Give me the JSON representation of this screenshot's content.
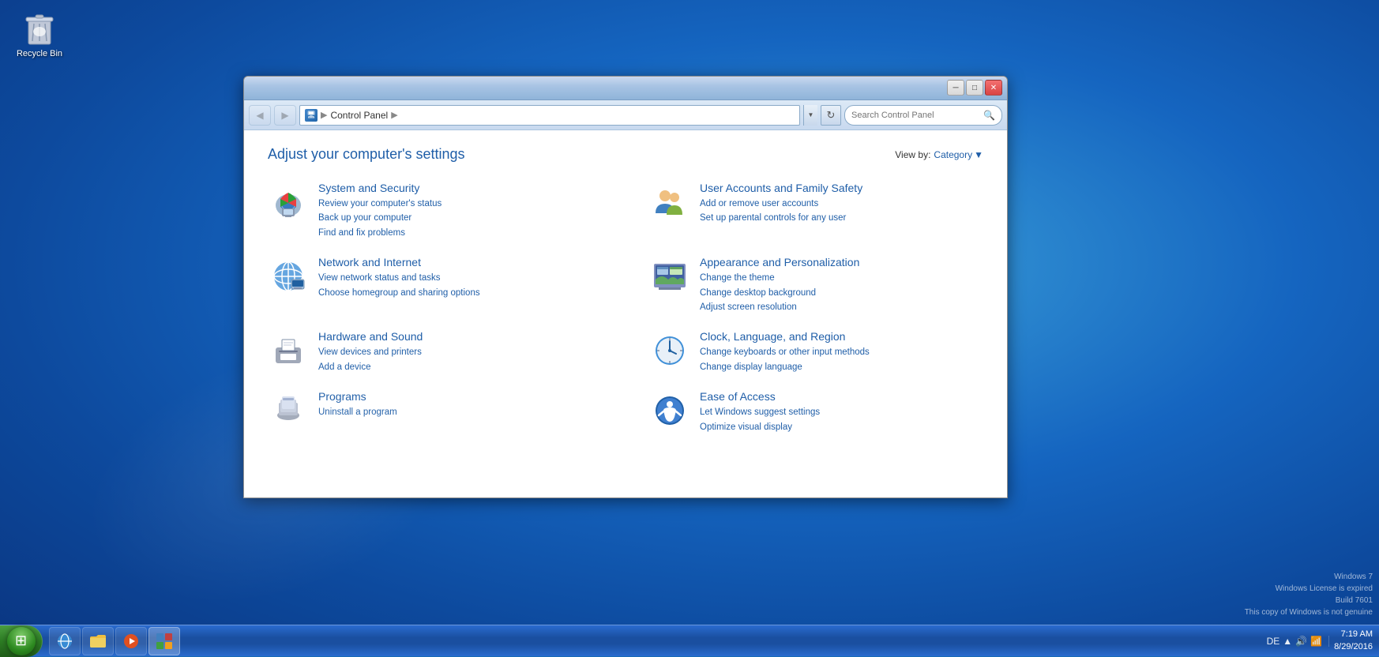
{
  "desktop": {
    "recycle_bin_label": "Recycle Bin"
  },
  "taskbar": {
    "start_label": "Start",
    "items": [
      {
        "name": "Internet Explorer",
        "icon": "ie"
      },
      {
        "name": "File Explorer",
        "icon": "folder"
      },
      {
        "name": "Media Player",
        "icon": "media"
      },
      {
        "name": "Control Panel",
        "icon": "control",
        "active": true
      }
    ],
    "clock": {
      "time": "7:19 AM",
      "date": "8/29/2016"
    },
    "tray_icons": [
      "DE",
      "▲",
      "🔊",
      "📶"
    ]
  },
  "watermark": {
    "line1": "Windows 7",
    "line2": "Windows License is expired",
    "line3": "Build 7601",
    "line4": "This copy of Windows is not genuine"
  },
  "window": {
    "title": "Control Panel",
    "nav": {
      "address_icon": "🖥",
      "address_parts": [
        "Control Panel"
      ],
      "search_placeholder": "Search Control Panel",
      "refresh_icon": "↻"
    },
    "content": {
      "heading": "Adjust your computer's settings",
      "view_by_label": "View by:",
      "view_by_value": "Category",
      "categories": [
        {
          "id": "system-security",
          "title": "System and Security",
          "links": [
            "Review your computer's status",
            "Back up your computer",
            "Find and fix problems"
          ]
        },
        {
          "id": "user-accounts",
          "title": "User Accounts and Family Safety",
          "links": [
            "Add or remove user accounts",
            "Set up parental controls for any user"
          ]
        },
        {
          "id": "network-internet",
          "title": "Network and Internet",
          "links": [
            "View network status and tasks",
            "Choose homegroup and sharing options"
          ]
        },
        {
          "id": "appearance",
          "title": "Appearance and Personalization",
          "links": [
            "Change the theme",
            "Change desktop background",
            "Adjust screen resolution"
          ]
        },
        {
          "id": "hardware-sound",
          "title": "Hardware and Sound",
          "links": [
            "View devices and printers",
            "Add a device"
          ]
        },
        {
          "id": "clock-language",
          "title": "Clock, Language, and Region",
          "links": [
            "Change keyboards or other input methods",
            "Change display language"
          ]
        },
        {
          "id": "programs",
          "title": "Programs",
          "links": [
            "Uninstall a program"
          ]
        },
        {
          "id": "ease-access",
          "title": "Ease of Access",
          "links": [
            "Let Windows suggest settings",
            "Optimize visual display"
          ]
        }
      ]
    }
  }
}
